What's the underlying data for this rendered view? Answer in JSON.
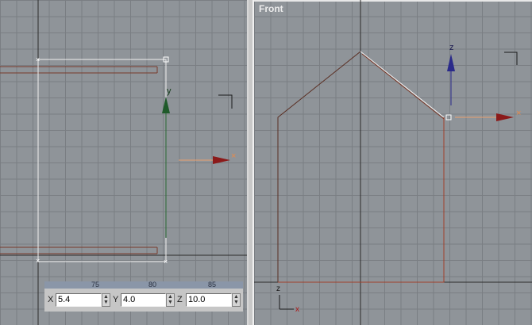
{
  "viewports": {
    "left": {
      "label": ""
    },
    "right": {
      "label": "Front"
    }
  },
  "gizmo": {
    "x_axis": "x",
    "y_axis": "y",
    "z_axis": "z"
  },
  "colors": {
    "grid_bg": "#8f9499",
    "grid_line": "#7a7e83",
    "spline": "#7a3a2a",
    "selection": "#ffffff",
    "x_axis": "#8b1a1a",
    "y_axis": "#1f5a2a",
    "z_axis": "#2a2a8a",
    "axis_cross": "#e88a4a"
  },
  "typein": {
    "ruler_ticks": [
      "75",
      "80",
      "85"
    ],
    "x": {
      "label": "X",
      "value": "5.4"
    },
    "y": {
      "label": "Y",
      "value": "4.0"
    },
    "z": {
      "label": "Z",
      "value": "10.0"
    }
  }
}
